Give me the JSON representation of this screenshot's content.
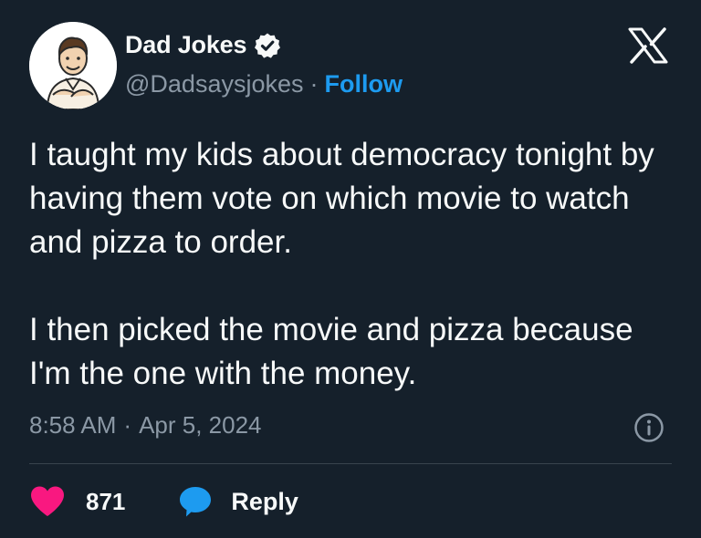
{
  "author": {
    "display_name": "Dad Jokes",
    "handle": "@Dadsaysjokes",
    "separator": "·",
    "follow_label": "Follow",
    "verified_icon": "verified-badge-icon",
    "avatar_icon": "cartoon-dad-avatar"
  },
  "tweet": {
    "paragraphs": [
      "I taught my kids about democracy tonight by having them vote on which movie to watch and pizza to order.",
      "I then picked the movie and pizza because I'm the one with the money."
    ]
  },
  "meta": {
    "time": "8:58 AM",
    "separator": "·",
    "date": "Apr 5, 2024",
    "info_icon": "info-icon"
  },
  "actions": {
    "like_count": "871",
    "reply_label": "Reply",
    "like_icon": "heart-icon",
    "reply_icon": "speech-bubble-icon"
  },
  "colors": {
    "background": "#15202b",
    "text": "#f7f9f9",
    "secondary_text": "#8b98a5",
    "accent": "#1d9bf0",
    "like": "#f91880",
    "divider": "#38444d"
  }
}
